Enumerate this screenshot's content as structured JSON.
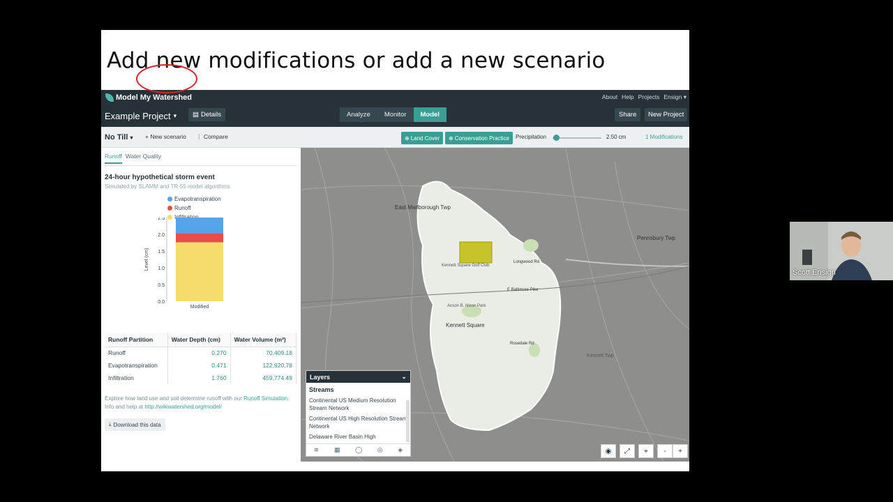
{
  "slide": {
    "title": "Add new modifications or add a new scenario"
  },
  "app": {
    "brand": "Model My Watershed",
    "links": [
      "About",
      "Help",
      "Projects",
      "Ensign"
    ],
    "project_name": "Example Project",
    "details_label": "Details",
    "nav_tabs": [
      "Analyze",
      "Monitor",
      "Model"
    ],
    "active_tab": "Model",
    "share_label": "Share",
    "new_project_label": "New Project"
  },
  "toolbar": {
    "scenario": "No Till",
    "new_scenario": "New scenario",
    "compare": "Compare",
    "land_cover": "Land Cover",
    "conservation": "Conservation Practice",
    "precip_label": "Precipitation",
    "precip_value": "2.50 cm",
    "modifications": "1 Modifications"
  },
  "results": {
    "tabs": [
      "Runoff",
      "Water Quality"
    ],
    "title": "24-hour hypothetical storm event",
    "subtitle": "Simulated by SLAMM and TR-55 model algorithms",
    "table": {
      "headers": [
        "Runoff Partition",
        "Water Depth (cm)",
        "Water Volume (m³)"
      ],
      "rows": [
        [
          "Runoff",
          "0.270",
          "70,409.18"
        ],
        [
          "Evapotranspiration",
          "0.471",
          "122,920.78"
        ],
        [
          "Infiltration",
          "1.760",
          "459,774.49"
        ]
      ]
    },
    "explore_text": "Explore how land use and soil determine runoff with our",
    "explore_link": "Runoff Simulation.",
    "info_text": "Info and help at",
    "info_link": "http://wikiwatershed.org/model/",
    "download_label": "Download this data"
  },
  "chart_data": {
    "type": "bar",
    "categories": [
      "Modified"
    ],
    "series": [
      {
        "name": "Infiltration",
        "values": [
          1.76
        ],
        "color": "#f6dc6d"
      },
      {
        "name": "Runoff",
        "values": [
          0.27
        ],
        "color": "#e64d4a"
      },
      {
        "name": "Evapotranspiration",
        "values": [
          0.471
        ],
        "color": "#56a3ea"
      }
    ],
    "stacked": true,
    "ylabel": "Level (cm)",
    "ylim": [
      0,
      2.5
    ],
    "yticks": [
      "0.0",
      "0.5",
      "1.0",
      "1.5",
      "2.0",
      "2.5"
    ]
  },
  "map": {
    "layers_title": "Layers",
    "layers_section": "Streams",
    "layers_items": [
      "Continental US Medium Resolution Stream Network",
      "Continental US High Resolution Stream Network",
      "Delaware River Basin High"
    ],
    "labels": [
      "East Marlborough Twp",
      "Kennett Square Golf Club",
      "Kennett Square",
      "Anson B. Nixon Park",
      "Kennett Twp",
      "Pennsbury Twp",
      "E Baltimore Pike",
      "Longwood Rd",
      "Rosedale Rd"
    ],
    "controls": [
      "+",
      "-"
    ]
  },
  "video": {
    "name": "Scott Ensign"
  }
}
